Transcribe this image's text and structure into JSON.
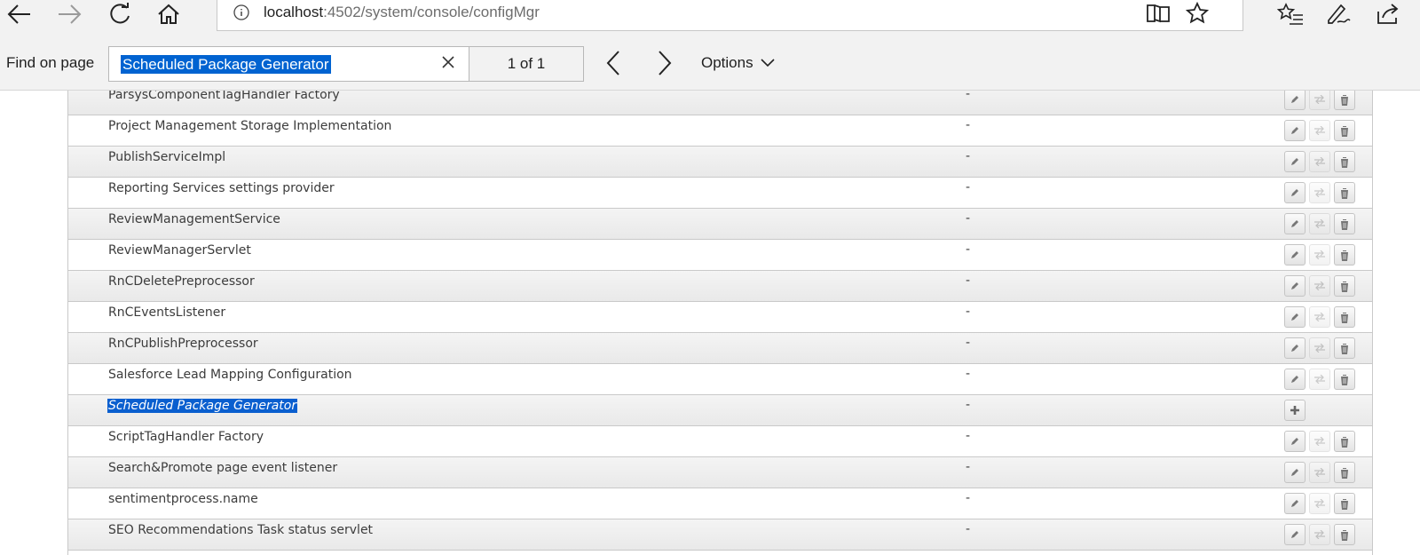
{
  "toolbar": {
    "back_icon": "arrow-left-icon",
    "forward_icon": "arrow-right-icon",
    "refresh_icon": "refresh-icon",
    "home_icon": "home-icon",
    "address": {
      "host": "localhost",
      "path": ":4502/system/console/configMgr"
    },
    "right_icons": [
      "reading-view-icon",
      "favorite-star-icon",
      "favorites-list-icon",
      "web-note-icon",
      "share-icon"
    ]
  },
  "findbar": {
    "label": "Find on page",
    "query": "Scheduled Package Generator",
    "count": "1 of 1",
    "options_label": "Options"
  },
  "table": {
    "rows": [
      {
        "name": "ParsysComponentTagHandler Factory",
        "bundle": "-",
        "factory": false
      },
      {
        "name": "Project Management Storage Implementation",
        "bundle": "-",
        "factory": false
      },
      {
        "name": "PublishServiceImpl",
        "bundle": "-",
        "factory": false
      },
      {
        "name": "Reporting Services settings provider",
        "bundle": "-",
        "factory": false
      },
      {
        "name": "ReviewManagementService",
        "bundle": "-",
        "factory": false
      },
      {
        "name": "ReviewManagerServlet",
        "bundle": "-",
        "factory": false
      },
      {
        "name": "RnCDeletePreprocessor",
        "bundle": "-",
        "factory": false
      },
      {
        "name": "RnCEventsListener",
        "bundle": "-",
        "factory": false
      },
      {
        "name": "RnCPublishPreprocessor",
        "bundle": "-",
        "factory": false
      },
      {
        "name": "Salesforce Lead Mapping Configuration",
        "bundle": "-",
        "factory": false
      },
      {
        "name": "Scheduled Package Generator",
        "bundle": "-",
        "factory": true,
        "highlighted": true
      },
      {
        "name": "ScriptTagHandler Factory",
        "bundle": "-",
        "factory": false
      },
      {
        "name": "Search&Promote page event listener",
        "bundle": "-",
        "factory": false
      },
      {
        "name": "sentimentprocess.name",
        "bundle": "-",
        "factory": false
      },
      {
        "name": "SEO Recommendations Task status servlet",
        "bundle": "-",
        "factory": false
      }
    ]
  },
  "colors": {
    "selection": "#0063d1",
    "row_alt": "#ececec",
    "text": "#3c3c3c"
  }
}
